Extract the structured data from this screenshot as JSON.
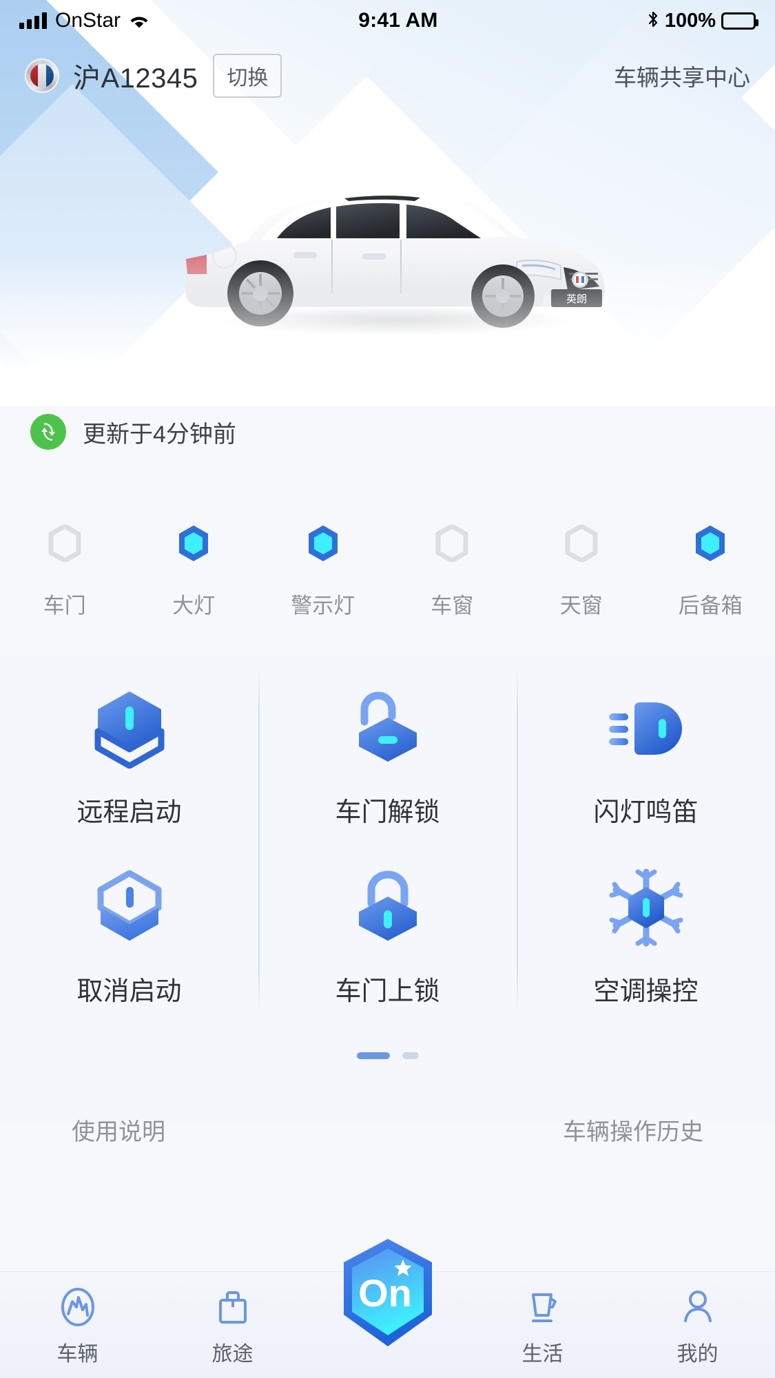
{
  "status_bar": {
    "carrier": "OnStar",
    "time": "9:41 AM",
    "battery_pct": "100%",
    "signal_icon": "signal-bars-icon",
    "wifi_icon": "wifi-icon",
    "bluetooth_icon": "bluetooth-icon",
    "battery_icon": "battery-full-icon"
  },
  "header": {
    "brand_logo": "buick-logo-icon",
    "plate": "沪A12345",
    "switch_label": "切换",
    "share_center_label": "车辆共享中心"
  },
  "hero": {
    "vehicle_image": "white-buick-excelle-sedan",
    "vehicle_badge": "英朗"
  },
  "update": {
    "refresh_icon": "refresh-circle-icon",
    "text": "更新于4分钟前",
    "icon_color": "#4ec34b"
  },
  "vehicle_status": {
    "items": [
      {
        "label": "车门",
        "active": false,
        "icon": "hexagon-status-icon"
      },
      {
        "label": "大灯",
        "active": true,
        "icon": "hexagon-status-icon"
      },
      {
        "label": "警示灯",
        "active": true,
        "icon": "hexagon-status-icon"
      },
      {
        "label": "车窗",
        "active": false,
        "icon": "hexagon-status-icon"
      },
      {
        "label": "天窗",
        "active": false,
        "icon": "hexagon-status-icon"
      },
      {
        "label": "后备箱",
        "active": true,
        "icon": "hexagon-status-icon"
      }
    ],
    "active_color": "#3ef0ff",
    "inactive_color": "#dcdee2"
  },
  "controls": {
    "items": [
      {
        "label": "远程启动",
        "icon": "remote-start-icon"
      },
      {
        "label": "车门解锁",
        "icon": "unlock-icon"
      },
      {
        "label": "闪灯鸣笛",
        "icon": "flash-horn-icon"
      },
      {
        "label": "取消启动",
        "icon": "cancel-start-icon"
      },
      {
        "label": "车门上锁",
        "icon": "lock-icon"
      },
      {
        "label": "空调操控",
        "icon": "snowflake-ac-icon"
      }
    ],
    "accent_color": "#3a74e0",
    "highlight_color": "#3ef0ff"
  },
  "pagination": {
    "total": 2,
    "current": 1
  },
  "links": {
    "left": "使用说明",
    "right": "车辆操作历史"
  },
  "tabbar": {
    "items": [
      {
        "label": "车辆",
        "icon": "vehicle-icon",
        "active": true
      },
      {
        "label": "旅途",
        "icon": "trip-bag-icon",
        "active": false
      },
      {
        "label": "",
        "icon": "onstar-logo-icon",
        "active": false,
        "badge_text": "On"
      },
      {
        "label": "生活",
        "icon": "life-cup-icon",
        "active": false
      },
      {
        "label": "我的",
        "icon": "profile-person-icon",
        "active": false
      }
    ],
    "icon_color": "#6b97e0"
  }
}
